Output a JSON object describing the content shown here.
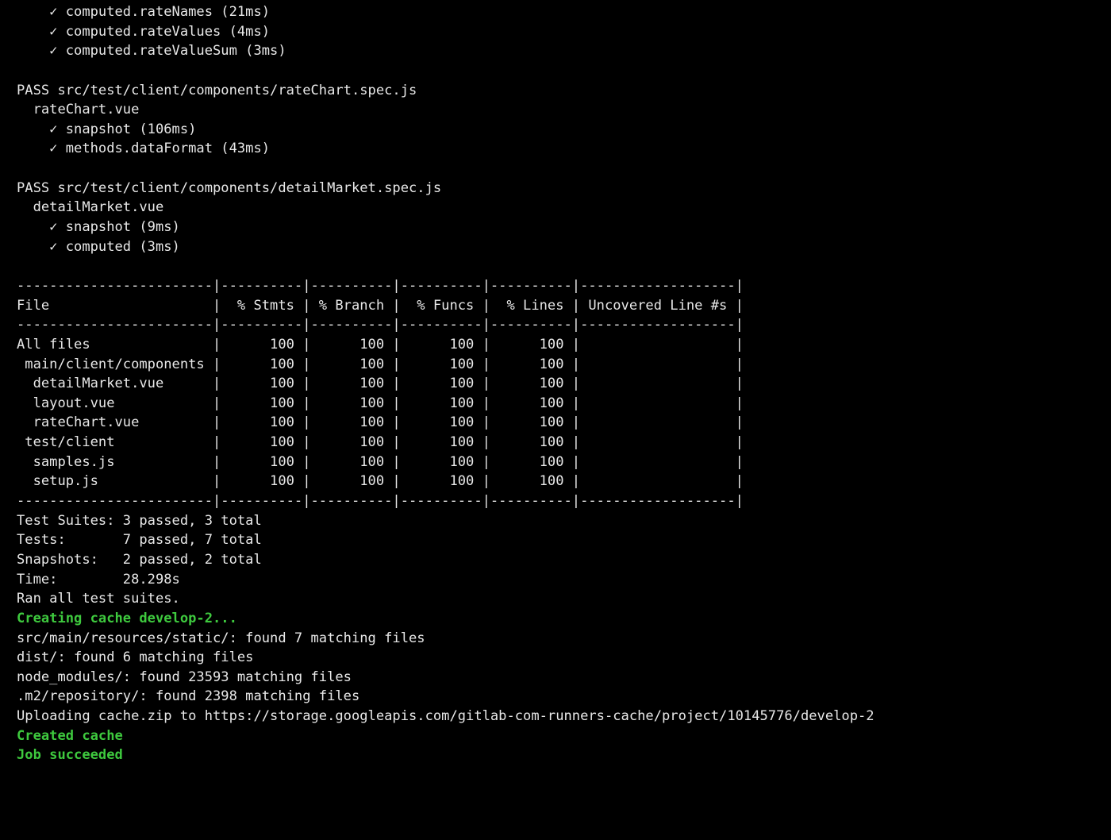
{
  "terminal": {
    "colors": {
      "background": "#000000",
      "text": "#e8e8e8",
      "success": "#3ec93e"
    },
    "lines": [
      {
        "text": "    ✓ computed.rateNames (21ms)",
        "style": "normal",
        "name": "test-result-line"
      },
      {
        "text": "    ✓ computed.rateValues (4ms)",
        "style": "normal",
        "name": "test-result-line"
      },
      {
        "text": "    ✓ computed.rateValueSum (3ms)",
        "style": "normal",
        "name": "test-result-line"
      },
      {
        "text": "",
        "style": "normal",
        "name": "blank-line"
      },
      {
        "text": "PASS src/test/client/components/rateChart.spec.js",
        "style": "normal",
        "name": "suite-pass-line"
      },
      {
        "text": "  rateChart.vue",
        "style": "normal",
        "name": "describe-line"
      },
      {
        "text": "    ✓ snapshot (106ms)",
        "style": "normal",
        "name": "test-result-line"
      },
      {
        "text": "    ✓ methods.dataFormat (43ms)",
        "style": "normal",
        "name": "test-result-line"
      },
      {
        "text": "",
        "style": "normal",
        "name": "blank-line"
      },
      {
        "text": "PASS src/test/client/components/detailMarket.spec.js",
        "style": "normal",
        "name": "suite-pass-line"
      },
      {
        "text": "  detailMarket.vue",
        "style": "normal",
        "name": "describe-line"
      },
      {
        "text": "    ✓ snapshot (9ms)",
        "style": "normal",
        "name": "test-result-line"
      },
      {
        "text": "    ✓ computed (3ms)",
        "style": "normal",
        "name": "test-result-line"
      },
      {
        "text": "",
        "style": "normal",
        "name": "blank-line"
      },
      {
        "text": "------------------------|----------|----------|----------|----------|-------------------|",
        "style": "normal",
        "name": "coverage-table-border"
      },
      {
        "text": "File                    |  % Stmts | % Branch |  % Funcs |  % Lines | Uncovered Line #s |",
        "style": "normal",
        "name": "coverage-table-header"
      },
      {
        "text": "------------------------|----------|----------|----------|----------|-------------------|",
        "style": "normal",
        "name": "coverage-table-border"
      },
      {
        "text": "All files               |      100 |      100 |      100 |      100 |                   |",
        "style": "normal",
        "name": "coverage-table-row"
      },
      {
        "text": " main/client/components |      100 |      100 |      100 |      100 |                   |",
        "style": "normal",
        "name": "coverage-table-row"
      },
      {
        "text": "  detailMarket.vue      |      100 |      100 |      100 |      100 |                   |",
        "style": "normal",
        "name": "coverage-table-row"
      },
      {
        "text": "  layout.vue            |      100 |      100 |      100 |      100 |                   |",
        "style": "normal",
        "name": "coverage-table-row"
      },
      {
        "text": "  rateChart.vue         |      100 |      100 |      100 |      100 |                   |",
        "style": "normal",
        "name": "coverage-table-row"
      },
      {
        "text": " test/client            |      100 |      100 |      100 |      100 |                   |",
        "style": "normal",
        "name": "coverage-table-row"
      },
      {
        "text": "  samples.js            |      100 |      100 |      100 |      100 |                   |",
        "style": "normal",
        "name": "coverage-table-row"
      },
      {
        "text": "  setup.js              |      100 |      100 |      100 |      100 |                   |",
        "style": "normal",
        "name": "coverage-table-row"
      },
      {
        "text": "------------------------|----------|----------|----------|----------|-------------------|",
        "style": "normal",
        "name": "coverage-table-border"
      },
      {
        "text": "Test Suites: 3 passed, 3 total",
        "style": "normal",
        "name": "summary-test-suites"
      },
      {
        "text": "Tests:       7 passed, 7 total",
        "style": "normal",
        "name": "summary-tests"
      },
      {
        "text": "Snapshots:   2 passed, 2 total",
        "style": "normal",
        "name": "summary-snapshots"
      },
      {
        "text": "Time:        28.298s",
        "style": "normal",
        "name": "summary-time"
      },
      {
        "text": "Ran all test suites.",
        "style": "normal",
        "name": "summary-ran-all"
      },
      {
        "text": "Creating cache develop-2...",
        "style": "green",
        "name": "cache-creating-line"
      },
      {
        "text": "src/main/resources/static/: found 7 matching files",
        "style": "normal",
        "name": "cache-match-line"
      },
      {
        "text": "dist/: found 6 matching files",
        "style": "normal",
        "name": "cache-match-line"
      },
      {
        "text": "node_modules/: found 23593 matching files",
        "style": "normal",
        "name": "cache-match-line"
      },
      {
        "text": ".m2/repository/: found 2398 matching files",
        "style": "normal",
        "name": "cache-match-line"
      },
      {
        "text": "Uploading cache.zip to https://storage.googleapis.com/gitlab-com-runners-cache/project/10145776/develop-2",
        "style": "normal",
        "name": "cache-upload-line"
      },
      {
        "text": "Created cache",
        "style": "green",
        "name": "cache-created-line"
      },
      {
        "text": "Job succeeded",
        "style": "green",
        "name": "job-succeeded-line"
      }
    ]
  }
}
